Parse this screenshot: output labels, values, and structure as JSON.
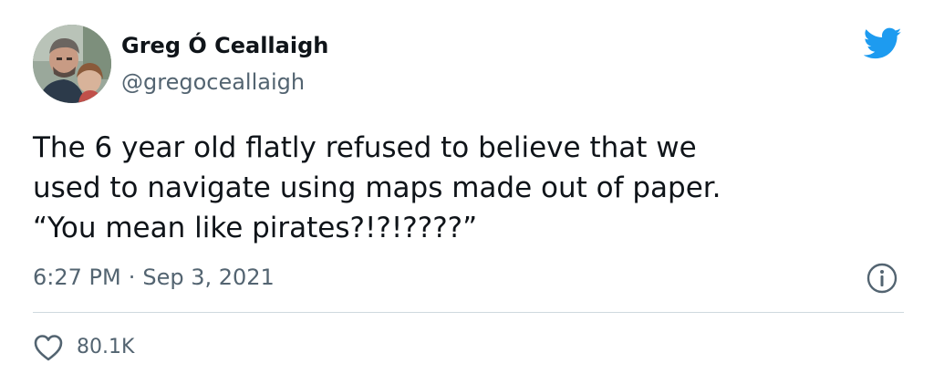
{
  "author": {
    "name": "Greg Ó Ceallaigh",
    "handle": "@gregoceallaigh",
    "avatar_icon": "profile-photo"
  },
  "tweet": {
    "text": "The 6 year old flatly refused to believe that we\nused to navigate using maps made out of paper.\n“You mean like pirates?!?!????”",
    "time": "6:27 PM",
    "separator": "·",
    "date": "Sep 3, 2021"
  },
  "engagement": {
    "likes": "80.1K",
    "like_icon": "heart-outline-icon"
  },
  "icons": {
    "brand": "twitter-bird-icon",
    "info": "info-circle-icon"
  },
  "colors": {
    "brand": "#1d9bf0",
    "text": "#0f1419",
    "secondary_text": "#536471",
    "divider": "#cfd9de"
  }
}
